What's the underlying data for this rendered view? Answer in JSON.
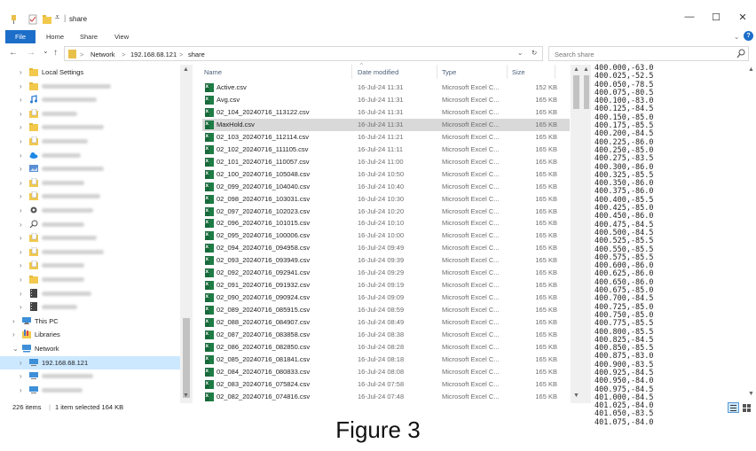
{
  "window": {
    "title": "share",
    "controls": {
      "minimize": "—",
      "maximize": "☐",
      "close": "✕"
    }
  },
  "ribbon": {
    "tabs": [
      "File",
      "Home",
      "Share",
      "View"
    ],
    "expand": "⌄",
    "help": "?"
  },
  "address": {
    "nav": {
      "back": "←",
      "forward": "→",
      "recent": "⌄",
      "up": "↑"
    },
    "breadcrumb": [
      "Network",
      "192.168.68.121",
      "share"
    ],
    "separator": ">",
    "dropdown": "⌄",
    "refresh": "↻",
    "search_placeholder": "Search share"
  },
  "sidebar": {
    "items": [
      {
        "label": "Local Settings",
        "icon": "folder-icon",
        "indent": 1
      },
      {
        "label": "",
        "icon": "folder-icon",
        "indent": 1,
        "redacted": true
      },
      {
        "label": "",
        "icon": "music-icon",
        "indent": 1,
        "redacted": true
      },
      {
        "label": "",
        "icon": "folder-doc-icon",
        "indent": 1,
        "redacted": true
      },
      {
        "label": "",
        "icon": "folder-icon",
        "indent": 1,
        "redacted": true
      },
      {
        "label": "",
        "icon": "folder-doc-icon",
        "indent": 1,
        "redacted": true
      },
      {
        "label": "",
        "icon": "onedrive-icon",
        "indent": 1,
        "redacted": true
      },
      {
        "label": "",
        "icon": "pictures-icon",
        "indent": 1,
        "redacted": true
      },
      {
        "label": "",
        "icon": "folder-doc-icon",
        "indent": 1,
        "redacted": true
      },
      {
        "label": "",
        "icon": "folder-doc-icon",
        "indent": 1,
        "redacted": true
      },
      {
        "label": "",
        "icon": "gear-icon",
        "indent": 1,
        "redacted": true
      },
      {
        "label": "",
        "icon": "search-icon",
        "indent": 1,
        "redacted": true
      },
      {
        "label": "",
        "icon": "folder-doc-icon",
        "indent": 1,
        "redacted": true
      },
      {
        "label": "",
        "icon": "folder-doc-icon",
        "indent": 1,
        "redacted": true
      },
      {
        "label": "",
        "icon": "folder-doc-icon",
        "indent": 1,
        "redacted": true
      },
      {
        "label": "",
        "icon": "folder-icon",
        "indent": 1,
        "redacted": true
      },
      {
        "label": "",
        "icon": "video-icon",
        "indent": 1,
        "redacted": true
      },
      {
        "label": "",
        "icon": "video-icon",
        "indent": 1,
        "redacted": true
      },
      {
        "label": "This PC",
        "icon": "pc-icon",
        "indent": 0
      },
      {
        "label": "Libraries",
        "icon": "library-icon",
        "indent": 0
      },
      {
        "label": "Network",
        "icon": "network-icon",
        "indent": 0,
        "expanded": true
      },
      {
        "label": "192.168.68.121",
        "icon": "monitor-icon",
        "indent": 1,
        "selected": true
      },
      {
        "label": "",
        "icon": "monitor-icon",
        "indent": 1,
        "redacted": true
      },
      {
        "label": "",
        "icon": "monitor-icon",
        "indent": 1,
        "redacted": true
      }
    ]
  },
  "columns": {
    "name": "Name",
    "date": "Date modified",
    "type": "Type",
    "size": "Size",
    "sort_indicator": "^"
  },
  "files": [
    {
      "name": "Active.csv",
      "date": "16-Jul-24 11:31",
      "type": "Microsoft Excel C...",
      "size": "152 KB"
    },
    {
      "name": "Avg.csv",
      "date": "16-Jul-24 11:31",
      "type": "Microsoft Excel C...",
      "size": "165 KB"
    },
    {
      "name": "02_104_20240716_113122.csv",
      "date": "16-Jul-24 11:31",
      "type": "Microsoft Excel C...",
      "size": "165 KB"
    },
    {
      "name": "MaxHold.csv",
      "date": "16-Jul-24 11:31",
      "type": "Microsoft Excel C...",
      "size": "165 KB",
      "selected": true
    },
    {
      "name": "02_103_20240716_112114.csv",
      "date": "16-Jul-24 11:21",
      "type": "Microsoft Excel C...",
      "size": "165 KB"
    },
    {
      "name": "02_102_20240716_111105.csv",
      "date": "16-Jul-24 11:11",
      "type": "Microsoft Excel C...",
      "size": "165 KB"
    },
    {
      "name": "02_101_20240716_110057.csv",
      "date": "16-Jul-24 11:00",
      "type": "Microsoft Excel C...",
      "size": "165 KB"
    },
    {
      "name": "02_100_20240716_105048.csv",
      "date": "16-Jul-24 10:50",
      "type": "Microsoft Excel C...",
      "size": "165 KB"
    },
    {
      "name": "02_099_20240716_104040.csv",
      "date": "16-Jul-24 10:40",
      "type": "Microsoft Excel C...",
      "size": "165 KB"
    },
    {
      "name": "02_098_20240716_103031.csv",
      "date": "16-Jul-24 10:30",
      "type": "Microsoft Excel C...",
      "size": "165 KB"
    },
    {
      "name": "02_097_20240716_102023.csv",
      "date": "16-Jul-24 10:20",
      "type": "Microsoft Excel C...",
      "size": "165 KB"
    },
    {
      "name": "02_096_20240716_101015.csv",
      "date": "16-Jul-24 10:10",
      "type": "Microsoft Excel C...",
      "size": "165 KB"
    },
    {
      "name": "02_095_20240716_100006.csv",
      "date": "16-Jul-24 10:00",
      "type": "Microsoft Excel C...",
      "size": "165 KB"
    },
    {
      "name": "02_094_20240716_094958.csv",
      "date": "16-Jul-24 09:49",
      "type": "Microsoft Excel C...",
      "size": "165 KB"
    },
    {
      "name": "02_093_20240716_093949.csv",
      "date": "16-Jul-24 09:39",
      "type": "Microsoft Excel C...",
      "size": "165 KB"
    },
    {
      "name": "02_092_20240716_092941.csv",
      "date": "16-Jul-24 09:29",
      "type": "Microsoft Excel C...",
      "size": "165 KB"
    },
    {
      "name": "02_091_20240716_091932.csv",
      "date": "16-Jul-24 09:19",
      "type": "Microsoft Excel C...",
      "size": "165 KB"
    },
    {
      "name": "02_090_20240716_090924.csv",
      "date": "16-Jul-24 09:09",
      "type": "Microsoft Excel C...",
      "size": "165 KB"
    },
    {
      "name": "02_089_20240716_085915.csv",
      "date": "16-Jul-24 08:59",
      "type": "Microsoft Excel C...",
      "size": "165 KB"
    },
    {
      "name": "02_088_20240716_084907.csv",
      "date": "16-Jul-24 08:49",
      "type": "Microsoft Excel C...",
      "size": "165 KB"
    },
    {
      "name": "02_087_20240716_083858.csv",
      "date": "16-Jul-24 08:38",
      "type": "Microsoft Excel C...",
      "size": "165 KB"
    },
    {
      "name": "02_086_20240716_082850.csv",
      "date": "16-Jul-24 08:28",
      "type": "Microsoft Excel C...",
      "size": "165 KB"
    },
    {
      "name": "02_085_20240716_081841.csv",
      "date": "16-Jul-24 08:18",
      "type": "Microsoft Excel C...",
      "size": "165 KB"
    },
    {
      "name": "02_084_20240716_080833.csv",
      "date": "16-Jul-24 08:08",
      "type": "Microsoft Excel C...",
      "size": "165 KB"
    },
    {
      "name": "02_083_20240716_075824.csv",
      "date": "16-Jul-24 07:58",
      "type": "Microsoft Excel C...",
      "size": "165 KB"
    },
    {
      "name": "02_082_20240716_074816.csv",
      "date": "16-Jul-24 07:48",
      "type": "Microsoft Excel C...",
      "size": "165 KB"
    }
  ],
  "preview_lines": [
    "400.000,-63.0",
    "400.025,-52.5",
    "400.050,-78.5",
    "400.075,-80.5",
    "400.100,-83.0",
    "400.125,-84.5",
    "400.150,-85.0",
    "400.175,-85.5",
    "400.200,-84.5",
    "400.225,-86.0",
    "400.250,-85.0",
    "400.275,-83.5",
    "400.300,-86.0",
    "400.325,-85.5",
    "400.350,-86.0",
    "400.375,-86.0",
    "400.400,-85.5",
    "400.425,-85.0",
    "400.450,-86.0",
    "400.475,-84.5",
    "400.500,-84.5",
    "400.525,-85.5",
    "400.550,-85.5",
    "400.575,-85.5",
    "400.600,-86.0",
    "400.625,-86.0",
    "400.650,-86.0",
    "400.675,-85.0",
    "400.700,-84.5",
    "400.725,-85.0",
    "400.750,-85.0",
    "400.775,-85.5",
    "400.800,-85.5",
    "400.825,-84.5",
    "400.850,-85.5",
    "400.875,-83.0",
    "400.900,-83.5",
    "400.925,-84.5",
    "400.950,-84.0",
    "400.975,-84.5",
    "401.000,-84.5",
    "401.025,-84.0",
    "401.050,-83.5",
    "401.075,-84.0"
  ],
  "status": {
    "count": "226 items",
    "selected": "1 item selected  164 KB"
  },
  "caption": "Figure 3",
  "colors": {
    "accent": "#1d6ec9",
    "selection": "#cce8ff",
    "excel_green": "#1f7c45"
  }
}
